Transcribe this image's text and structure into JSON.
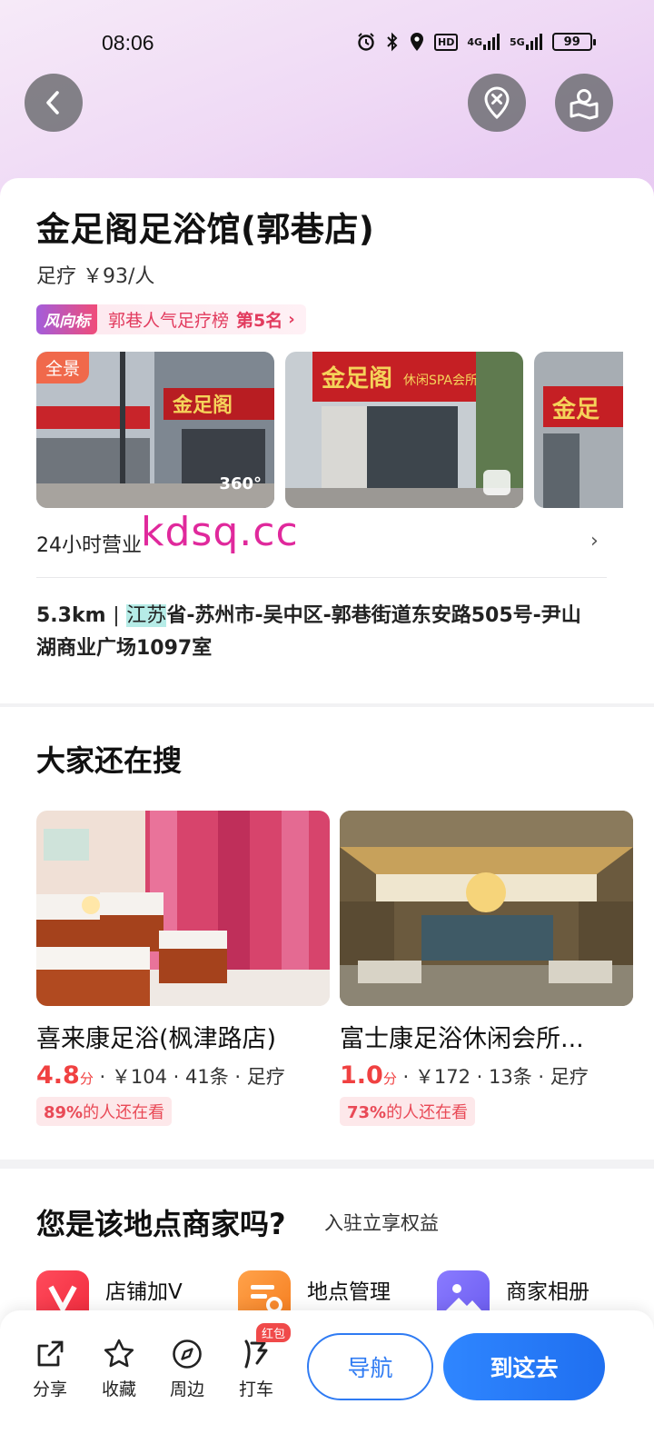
{
  "status_bar": {
    "time": "08:06",
    "net1": "4G",
    "net2": "5G",
    "hd": "HD",
    "battery": "99"
  },
  "shop": {
    "title": "金足阁足浴馆(郭巷店)",
    "category_price": "足疗 ￥93/人",
    "rank_tag": "风向标",
    "rank_text": "郭巷人气足疗榜",
    "rank_position": "第5名",
    "panorama_label": "全景",
    "pano_360": "360°",
    "hours": "24小时营业",
    "watermark": "kdsq.cc",
    "address_distance": "5.3km",
    "address_sep": "|",
    "address_highlight": "江苏",
    "address_rest": "省-苏州市-吴中区-郭巷街道东安路505号-尹山湖商业广场1097室"
  },
  "recommend": {
    "title": "大家还在搜",
    "items": [
      {
        "name": "喜来康足浴(枫津路店)",
        "score": "4.8",
        "score_unit": "分",
        "meta": "· ￥104 · 41条 · 足疗",
        "pill_percent": "89%",
        "pill_text": "的人还在看"
      },
      {
        "name": "富士康足浴休闲会所...",
        "score": "1.0",
        "score_unit": "分",
        "meta": "· ￥172 · 13条 · 足疗",
        "pill_percent": "73%",
        "pill_text": "的人还在看"
      }
    ]
  },
  "merchant": {
    "title": "您是该地点商家吗?",
    "subtitle": "入驻立享权益",
    "services": [
      {
        "label": "店铺加V"
      },
      {
        "label": "地点管理"
      },
      {
        "label": "商家相册"
      }
    ]
  },
  "bottom_bar": {
    "share": "分享",
    "favorite": "收藏",
    "nearby": "周边",
    "taxi": "打车",
    "hongbao": "红包",
    "navigate": "导航",
    "go_here": "到这去"
  },
  "colors": {
    "accent_blue": "#2f7bf3",
    "rank_red": "#e23b5e",
    "score_red": "#f04141",
    "highlight": "#b6ece7"
  }
}
